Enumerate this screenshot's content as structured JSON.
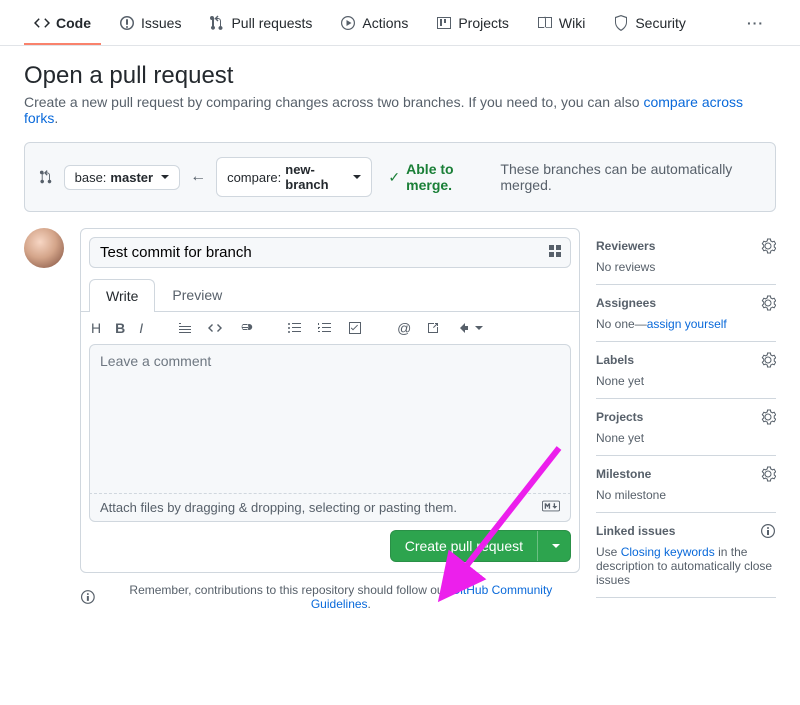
{
  "nav": {
    "items": [
      {
        "label": "Code"
      },
      {
        "label": "Issues"
      },
      {
        "label": "Pull requests"
      },
      {
        "label": "Actions"
      },
      {
        "label": "Projects"
      },
      {
        "label": "Wiki"
      },
      {
        "label": "Security"
      }
    ]
  },
  "page": {
    "title": "Open a pull request",
    "subtitle_pre": "Create a new pull request by comparing changes across two branches. If you need to, you can also ",
    "subtitle_link": "compare across forks",
    "subtitle_post": "."
  },
  "branches": {
    "base_label": "base: ",
    "base_value": "master",
    "compare_label": "compare: ",
    "compare_value": "new-branch",
    "able_label": "Able to merge.",
    "able_msg": "These branches can be automatically merged."
  },
  "compose": {
    "title_value": "Test commit for branch",
    "tab_write": "Write",
    "tab_preview": "Preview",
    "comment_placeholder": "Leave a comment",
    "attach_text": "Attach files by dragging & dropping, selecting or pasting them.",
    "submit_label": "Create pull request"
  },
  "remember": {
    "pre": "Remember, contributions to this repository should follow our ",
    "link": "GitHub Community Guidelines",
    "post": "."
  },
  "sidebar": {
    "reviewers": {
      "title": "Reviewers",
      "body": "No reviews"
    },
    "assignees": {
      "title": "Assignees",
      "body_pre": "No one—",
      "body_link": "assign yourself"
    },
    "labels": {
      "title": "Labels",
      "body": "None yet"
    },
    "projects": {
      "title": "Projects",
      "body": "None yet"
    },
    "milestone": {
      "title": "Milestone",
      "body": "No milestone"
    },
    "linked": {
      "title": "Linked issues",
      "body_pre": "Use ",
      "body_link": "Closing keywords",
      "body_post": " in the description to automatically close issues"
    }
  }
}
